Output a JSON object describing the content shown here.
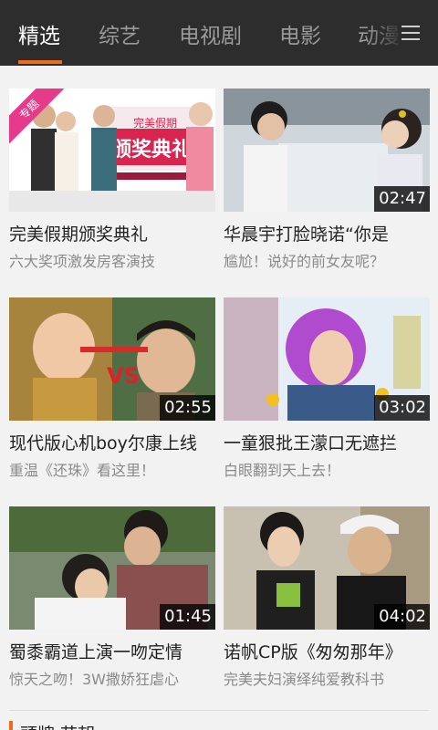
{
  "tabs": [
    {
      "label": "精选",
      "active": true
    },
    {
      "label": "综艺",
      "active": false
    },
    {
      "label": "电视剧",
      "active": false
    },
    {
      "label": "电影",
      "active": false
    },
    {
      "label": "动漫",
      "active": false
    }
  ],
  "menu_icon": "hamburger-menu-icon",
  "colors": {
    "accent": "#f26b1d",
    "topbar": "#2d2d2d",
    "badge": "#e63a8a"
  },
  "videos": [
    {
      "title": "完美假期颁奖典礼",
      "subtitle": "六大奖项激发房客演技",
      "duration": "",
      "badge": "专题"
    },
    {
      "title": "华晨宇打脸晓诺“你是",
      "subtitle": "尴尬！说好的前女友呢？",
      "duration": "02:47",
      "badge": ""
    },
    {
      "title": "现代版心机boy尔康上线",
      "subtitle": "重温《还珠》看这里！",
      "duration": "02:55",
      "badge": ""
    },
    {
      "title": "一童狠批王濛口无遮拦",
      "subtitle": "白眼翻到天上去！",
      "duration": "03:02",
      "badge": ""
    },
    {
      "title": "蜀黍霸道上演一吻定情",
      "subtitle": "惊天之吻！3W撒娇狂虐心",
      "duration": "01:45",
      "badge": ""
    },
    {
      "title": "诺帆CP版《匆匆那年》",
      "subtitle": "完美夫妇演绎纯爱教科书",
      "duration": "04:02",
      "badge": ""
    }
  ],
  "next_section": {
    "title": "頭牌 节朝"
  }
}
